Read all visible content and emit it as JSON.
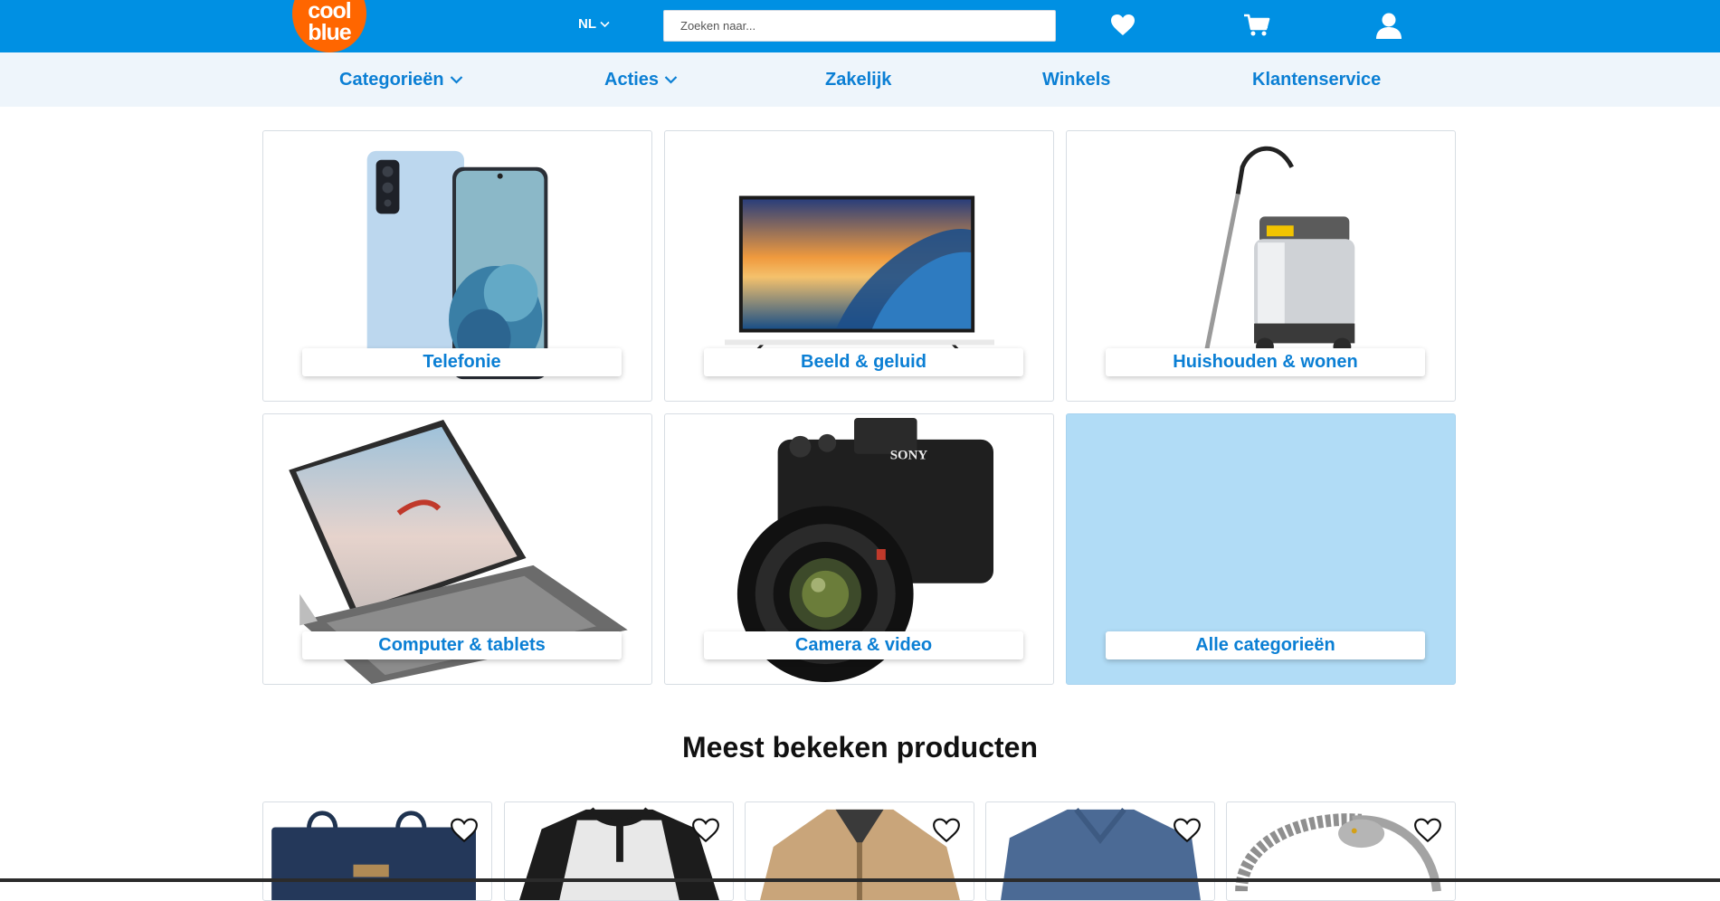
{
  "header": {
    "logo_line1": "cool",
    "logo_line2": "blue",
    "language": "NL",
    "search_placeholder": "Zoeken naar...",
    "icons": [
      "heart-icon",
      "cart-icon",
      "user-icon"
    ]
  },
  "nav": {
    "items": [
      {
        "label": "Categorieën",
        "has_dropdown": true
      },
      {
        "label": "Acties",
        "has_dropdown": true
      },
      {
        "label": "Zakelijk",
        "has_dropdown": false
      },
      {
        "label": "Winkels",
        "has_dropdown": false
      },
      {
        "label": "Klantenservice",
        "has_dropdown": false
      }
    ]
  },
  "categories": [
    {
      "label": "Telefonie",
      "image": "smartphone"
    },
    {
      "label": "Beeld & geluid",
      "image": "television"
    },
    {
      "label": "Huishouden & wonen",
      "image": "vacuum-cleaner"
    },
    {
      "label": "Computer & tablets",
      "image": "tablet-with-keyboard"
    },
    {
      "label": "Camera & video",
      "image": "camera"
    },
    {
      "label": "Alle categorieën",
      "image": "none"
    }
  ],
  "most_viewed": {
    "title": "Meest bekeken producten",
    "products": [
      {
        "image": "navy-bag"
      },
      {
        "image": "raglan-shirt"
      },
      {
        "image": "beige-jacket"
      },
      {
        "image": "blue-v-neck-shirt"
      },
      {
        "image": "dragon-bracelet"
      }
    ]
  },
  "colors": {
    "brand_blue": "#0090e3",
    "link_blue": "#0b7fd4",
    "logo_orange": "#ff6600",
    "nav_bg": "#eef5fb",
    "all_categories_bg": "#b1dcf6"
  }
}
